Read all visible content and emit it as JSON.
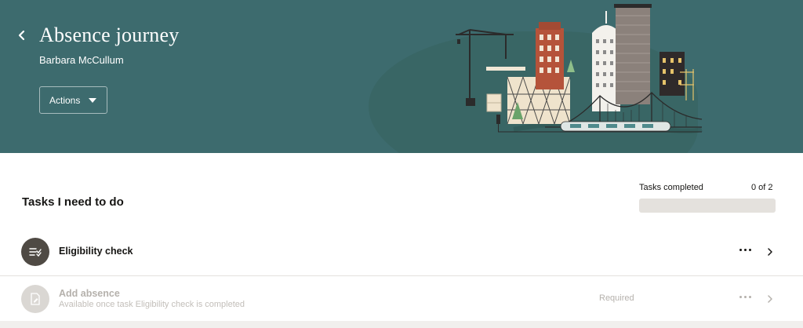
{
  "header": {
    "title": "Absence journey",
    "person_name": "Barbara McCullum",
    "actions_label": "Actions",
    "back_icon": "chevron-left-icon",
    "banner_color": "#3d6b6e"
  },
  "tasks": {
    "heading": "Tasks I need to do",
    "progress": {
      "label": "Tasks completed",
      "count_text": "0 of 2",
      "completed": 0,
      "total": 2
    },
    "items": [
      {
        "name": "Eligibility check",
        "subtitle": "",
        "status": "",
        "icon": "checklist-icon",
        "enabled": true
      },
      {
        "name": "Add absence",
        "subtitle": "Available once task Eligibility check is completed",
        "status": "Required",
        "icon": "document-edit-icon",
        "enabled": false
      }
    ]
  }
}
